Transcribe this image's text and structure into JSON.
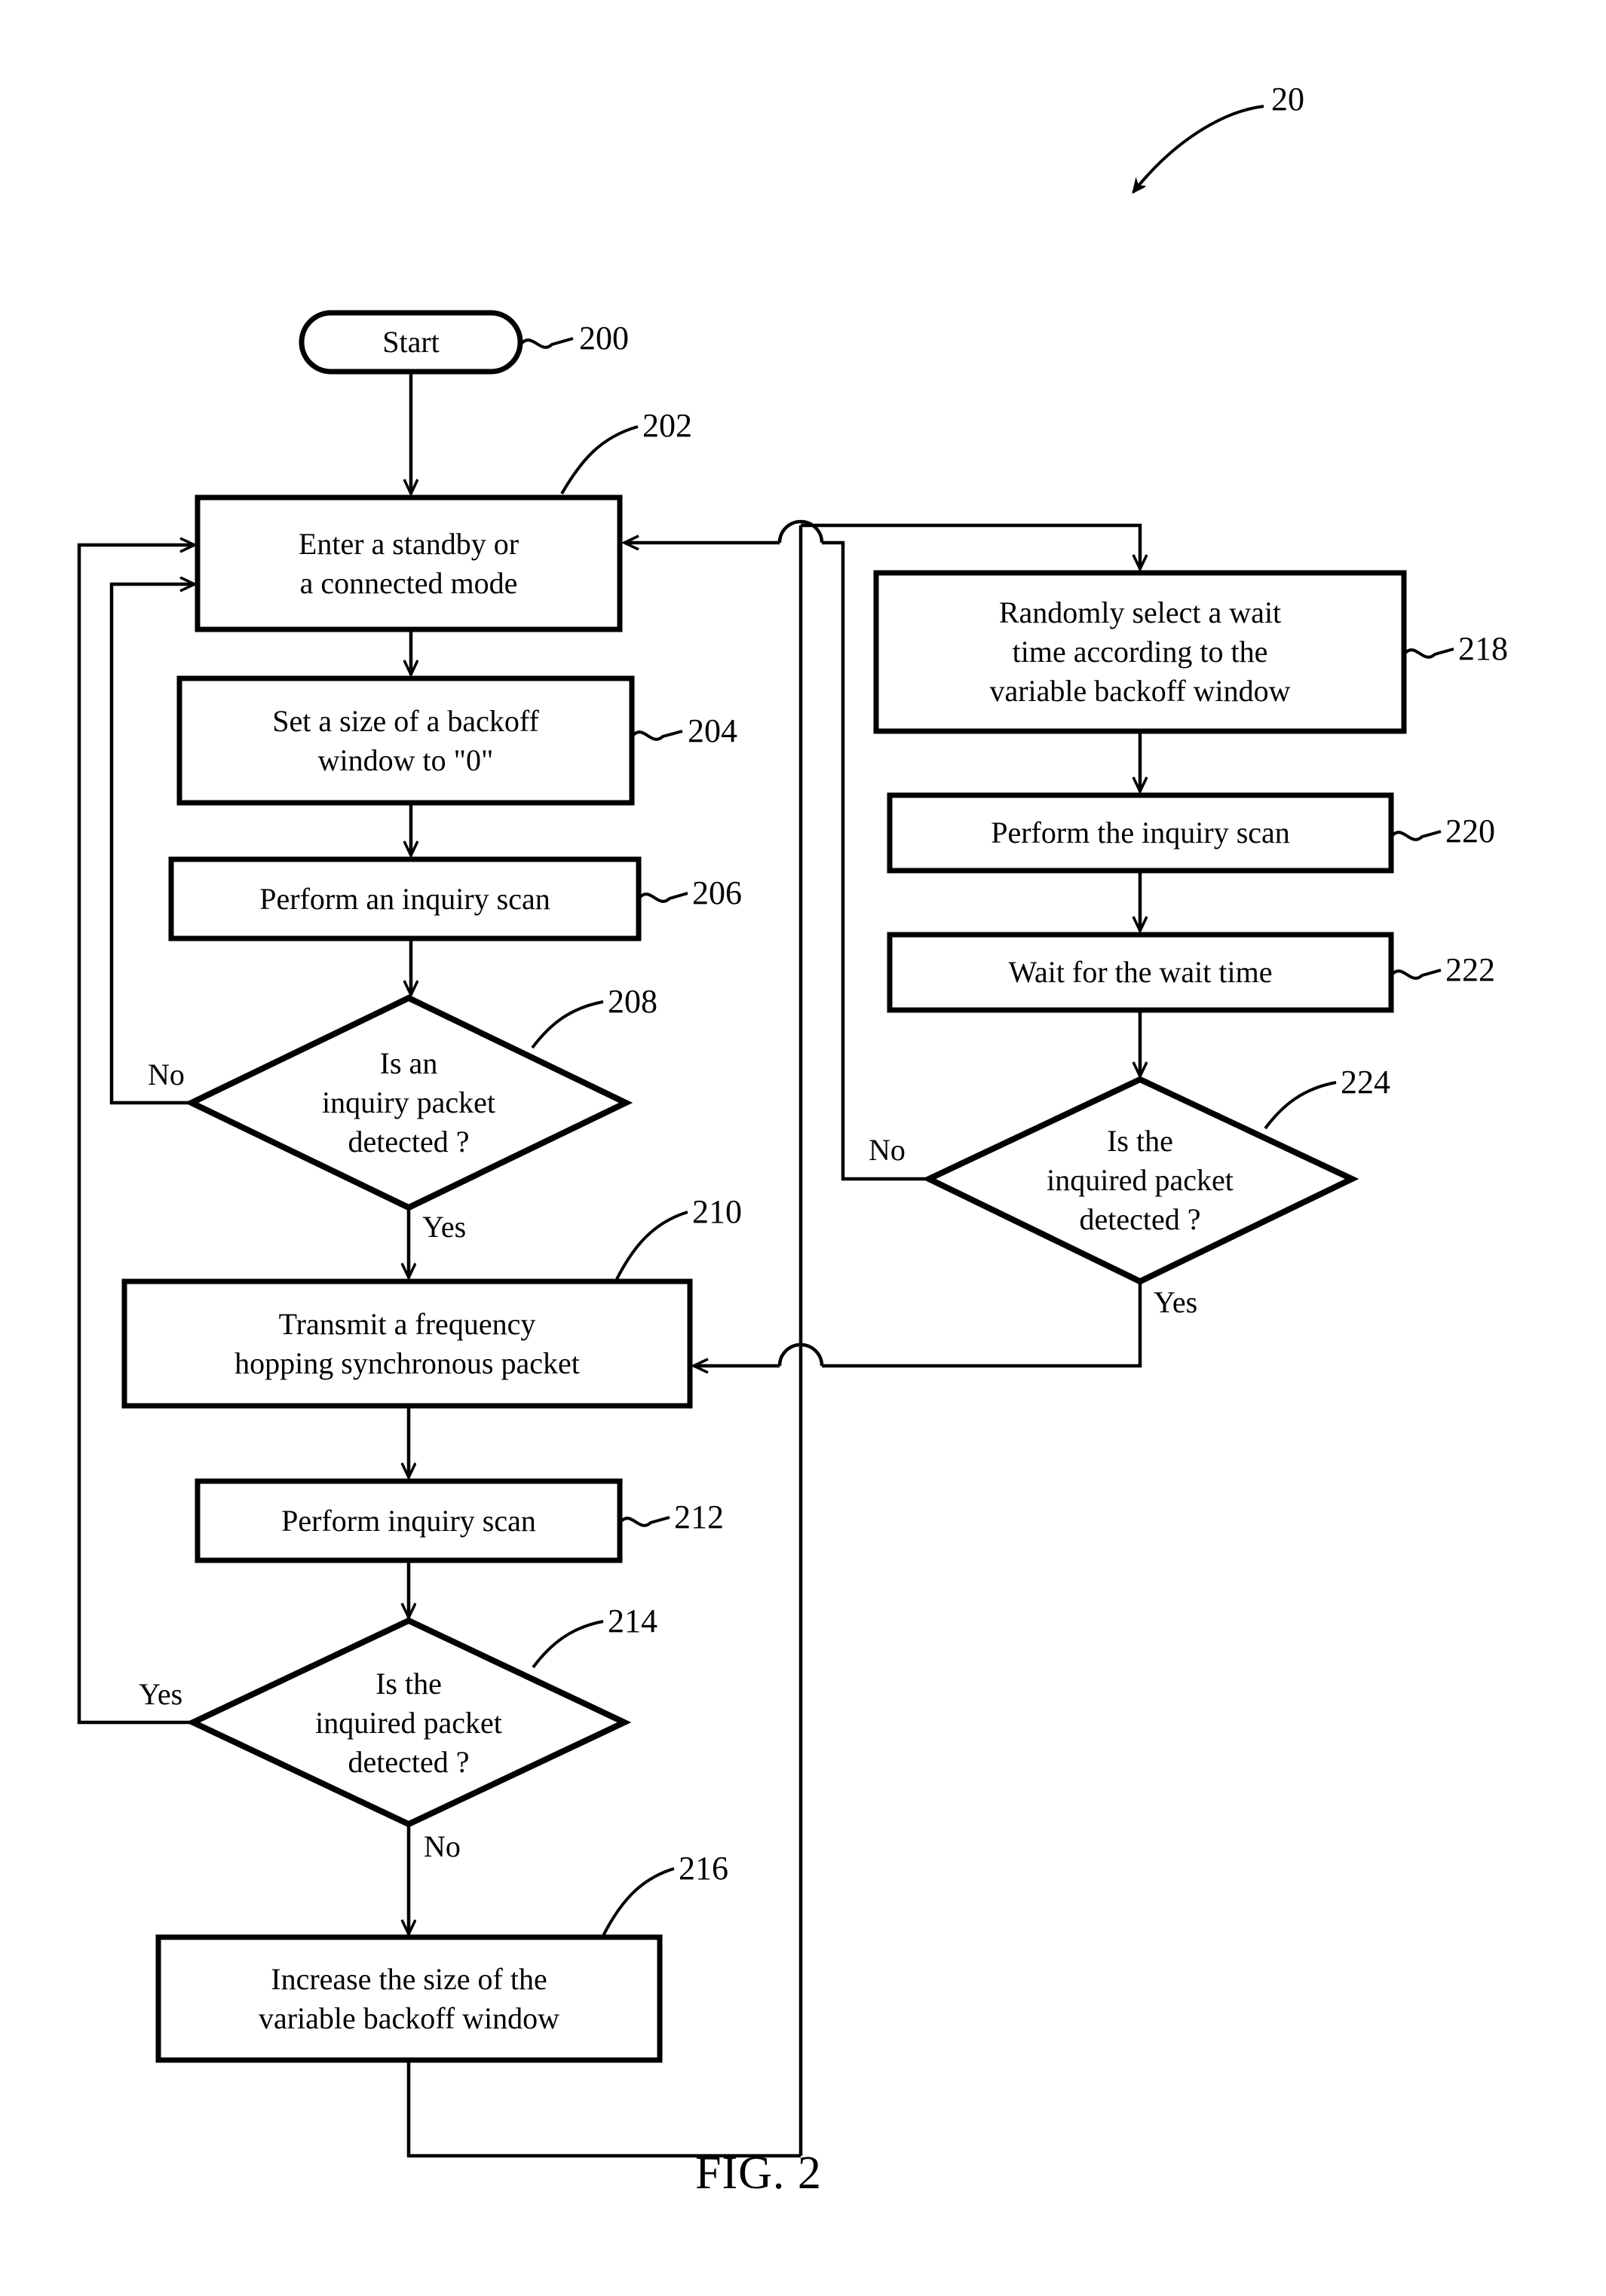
{
  "figure": {
    "caption": "FIG. 2",
    "overall_ref": "20"
  },
  "nodes": [
    {
      "id": "200",
      "shape": "terminator",
      "ref": "200",
      "text": "Start"
    },
    {
      "id": "202",
      "shape": "process",
      "ref": "202",
      "text": "Enter a standby or\na connected mode"
    },
    {
      "id": "204",
      "shape": "process",
      "ref": "204",
      "text": "Set a size of a backoff\nwindow to \"0\""
    },
    {
      "id": "206",
      "shape": "process",
      "ref": "206",
      "text": "Perform an inquiry scan"
    },
    {
      "id": "208",
      "shape": "decision",
      "ref": "208",
      "text": "Is an\ninquiry packet\ndetected ?"
    },
    {
      "id": "210",
      "shape": "process",
      "ref": "210",
      "text": "Transmit a frequency\nhopping synchronous packet"
    },
    {
      "id": "212",
      "shape": "process",
      "ref": "212",
      "text": "Perform inquiry scan"
    },
    {
      "id": "214",
      "shape": "decision",
      "ref": "214",
      "text": "Is the\ninquired packet\ndetected ?"
    },
    {
      "id": "216",
      "shape": "process",
      "ref": "216",
      "text": "Increase the size of the\nvariable backoff window"
    },
    {
      "id": "218",
      "shape": "process",
      "ref": "218",
      "text": "Randomly select a wait\ntime according to the\nvariable backoff window"
    },
    {
      "id": "220",
      "shape": "process",
      "ref": "220",
      "text": "Perform the inquiry scan"
    },
    {
      "id": "222",
      "shape": "process",
      "ref": "222",
      "text": "Wait for the wait time"
    },
    {
      "id": "224",
      "shape": "decision",
      "ref": "224",
      "text": "Is the\ninquired packet\ndetected ?"
    }
  ],
  "edge_labels": {
    "d208_no": "No",
    "d208_yes": "Yes",
    "d214_yes": "Yes",
    "d214_no": "No",
    "d224_no": "No",
    "d224_yes": "Yes"
  },
  "style": {
    "stroke": "#000000",
    "fill": "#ffffff"
  }
}
